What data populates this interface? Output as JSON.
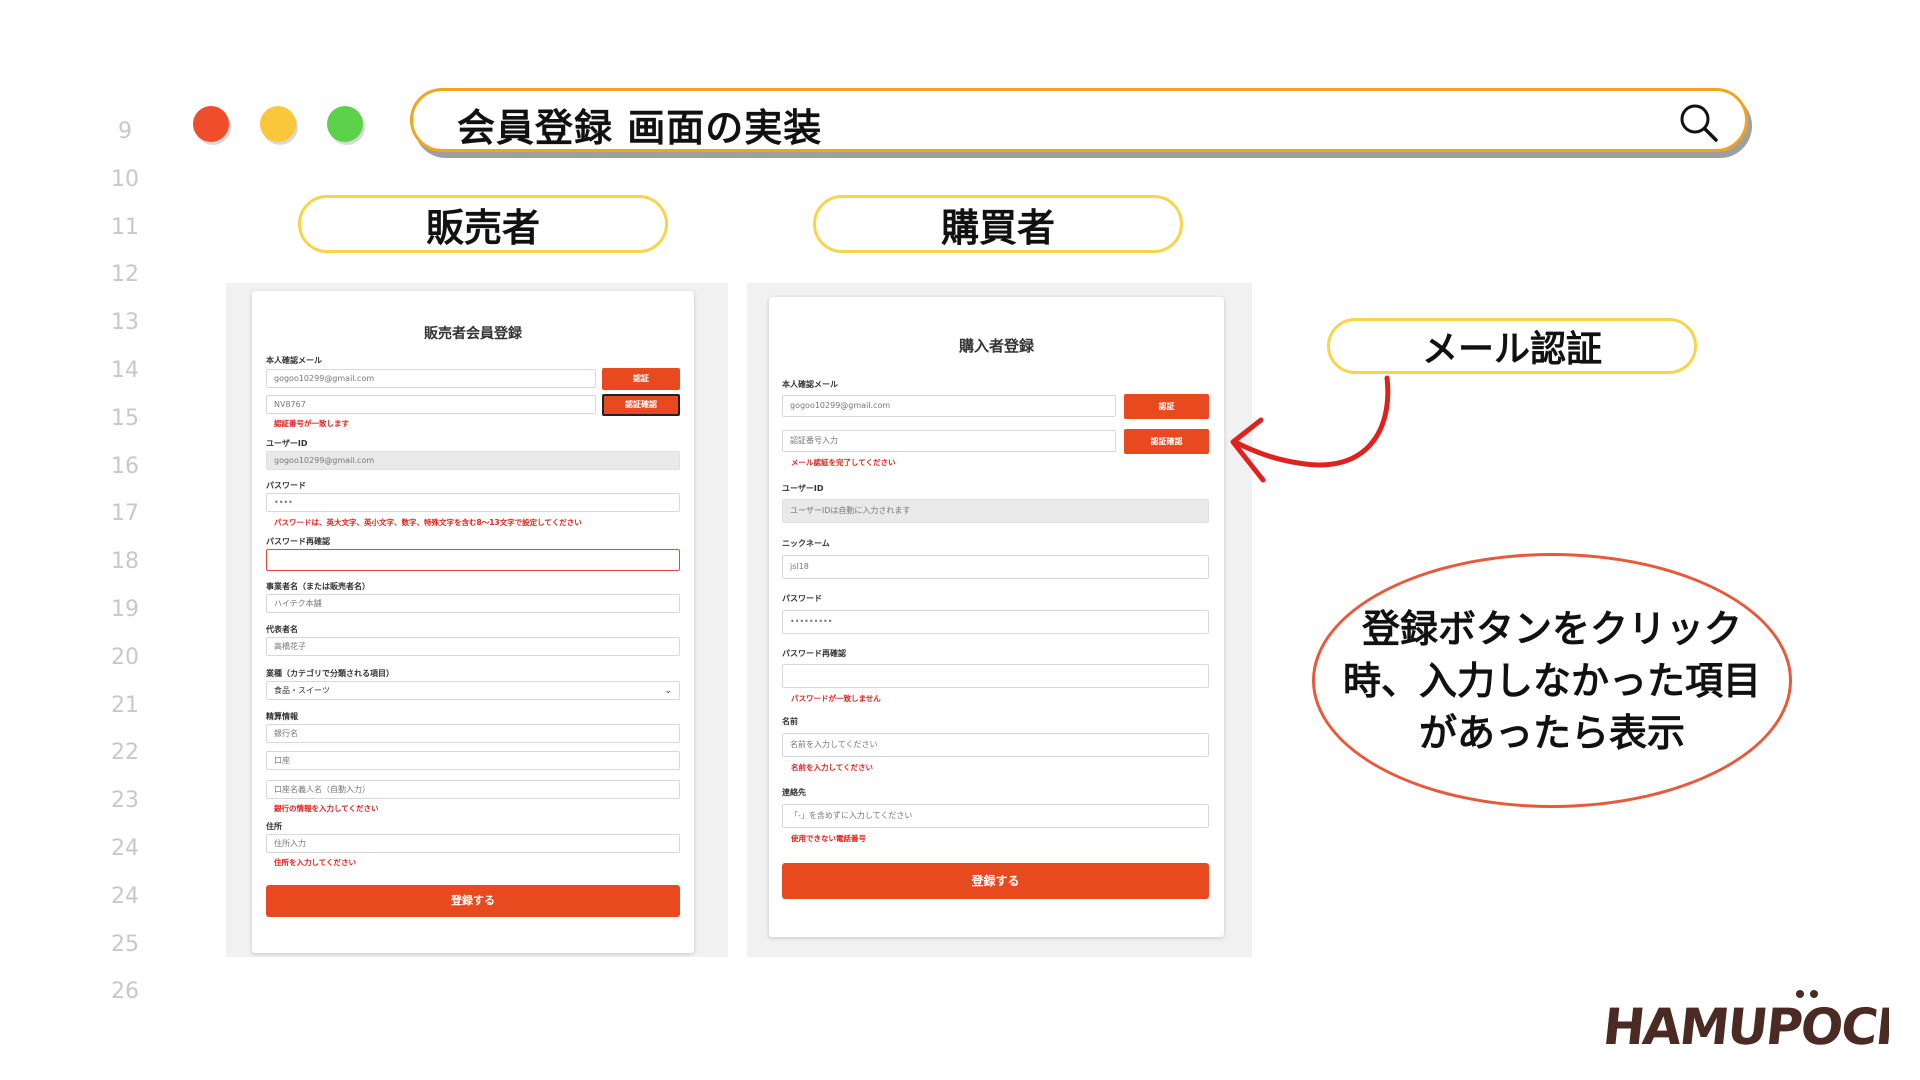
{
  "line_numbers": [
    "9",
    "10",
    "11",
    "12",
    "13",
    "14",
    "15",
    "16",
    "17",
    "18",
    "19",
    "20",
    "21",
    "22",
    "23",
    "24",
    "24",
    "25",
    "26"
  ],
  "title": "会員登録 画面の実装",
  "labels": {
    "seller": "販売者",
    "buyer": "購買者",
    "mail_auth": "メール認証"
  },
  "bubble": "登録ボタンをクリック時、入力しなかった項目があったら表示",
  "logo": "HAMUPOCHI",
  "seller_form": {
    "title": "販売者会員登録",
    "email_label": "本人確認メール",
    "email_value": "gogoo10299@gmail.com",
    "auth_button": "認証",
    "code_value": "NV8767",
    "code_button": "認証確認",
    "code_error": "認証番号が一致します",
    "userid_label": "ユーザーID",
    "userid_value": "gogoo10299@gmail.com",
    "password_label": "パスワード",
    "password_value": "••••",
    "password_error": "パスワードは、英大文字、英小文字、数字、特殊文字を含む8〜13文字で設定してください",
    "password_confirm_label": "パスワード再確認",
    "password_confirm_value": "",
    "business_label": "事業者名（または販売者名）",
    "business_value": "ハイテク本舗",
    "rep_label": "代表者名",
    "rep_value": "高橋花子",
    "category_label": "業種（カテゴリで分類される項目）",
    "category_value": "食品・スイーツ",
    "account_label": "精算情報",
    "bank_placeholder": "銀行名",
    "account_placeholder": "口座",
    "holder_placeholder": "口座名義人名（自動入力）",
    "bank_error": "銀行の情報を入力してください",
    "address_label": "住所",
    "address_placeholder": "住所入力",
    "address_error": "住所を入力してください",
    "submit": "登録する"
  },
  "buyer_form": {
    "title": "購入者登録",
    "email_label": "本人確認メール",
    "email_value": "gogoo10299@gmail.com",
    "auth_button": "認証",
    "code_placeholder": "認証番号入力",
    "code_button": "認証確認",
    "mail_error": "メール認証を完了してください",
    "userid_label": "ユーザーID",
    "userid_placeholder": "ユーザーIDは自動に入力されます",
    "nickname_label": "ニックネーム",
    "nickname_value": "jsl18",
    "password_label": "パスワード",
    "password_value": "•••••••••",
    "password_confirm_label": "パスワード再確認",
    "password_error": "パスワードが一致しません",
    "name_label": "名前",
    "name_placeholder": "名前を入力してください",
    "name_error": "名前を入力してください",
    "phone_label": "連絡先",
    "phone_placeholder": "「-」を含めずに入力してください",
    "phone_error": "使用できない電話番号",
    "submit": "登録する"
  },
  "colors": {
    "accent_orange": "#e8491e",
    "title_border": "#f4a31c",
    "pill_border": "#f6d54a",
    "error_red": "#e0221e",
    "bubble_border": "#e8583a"
  }
}
